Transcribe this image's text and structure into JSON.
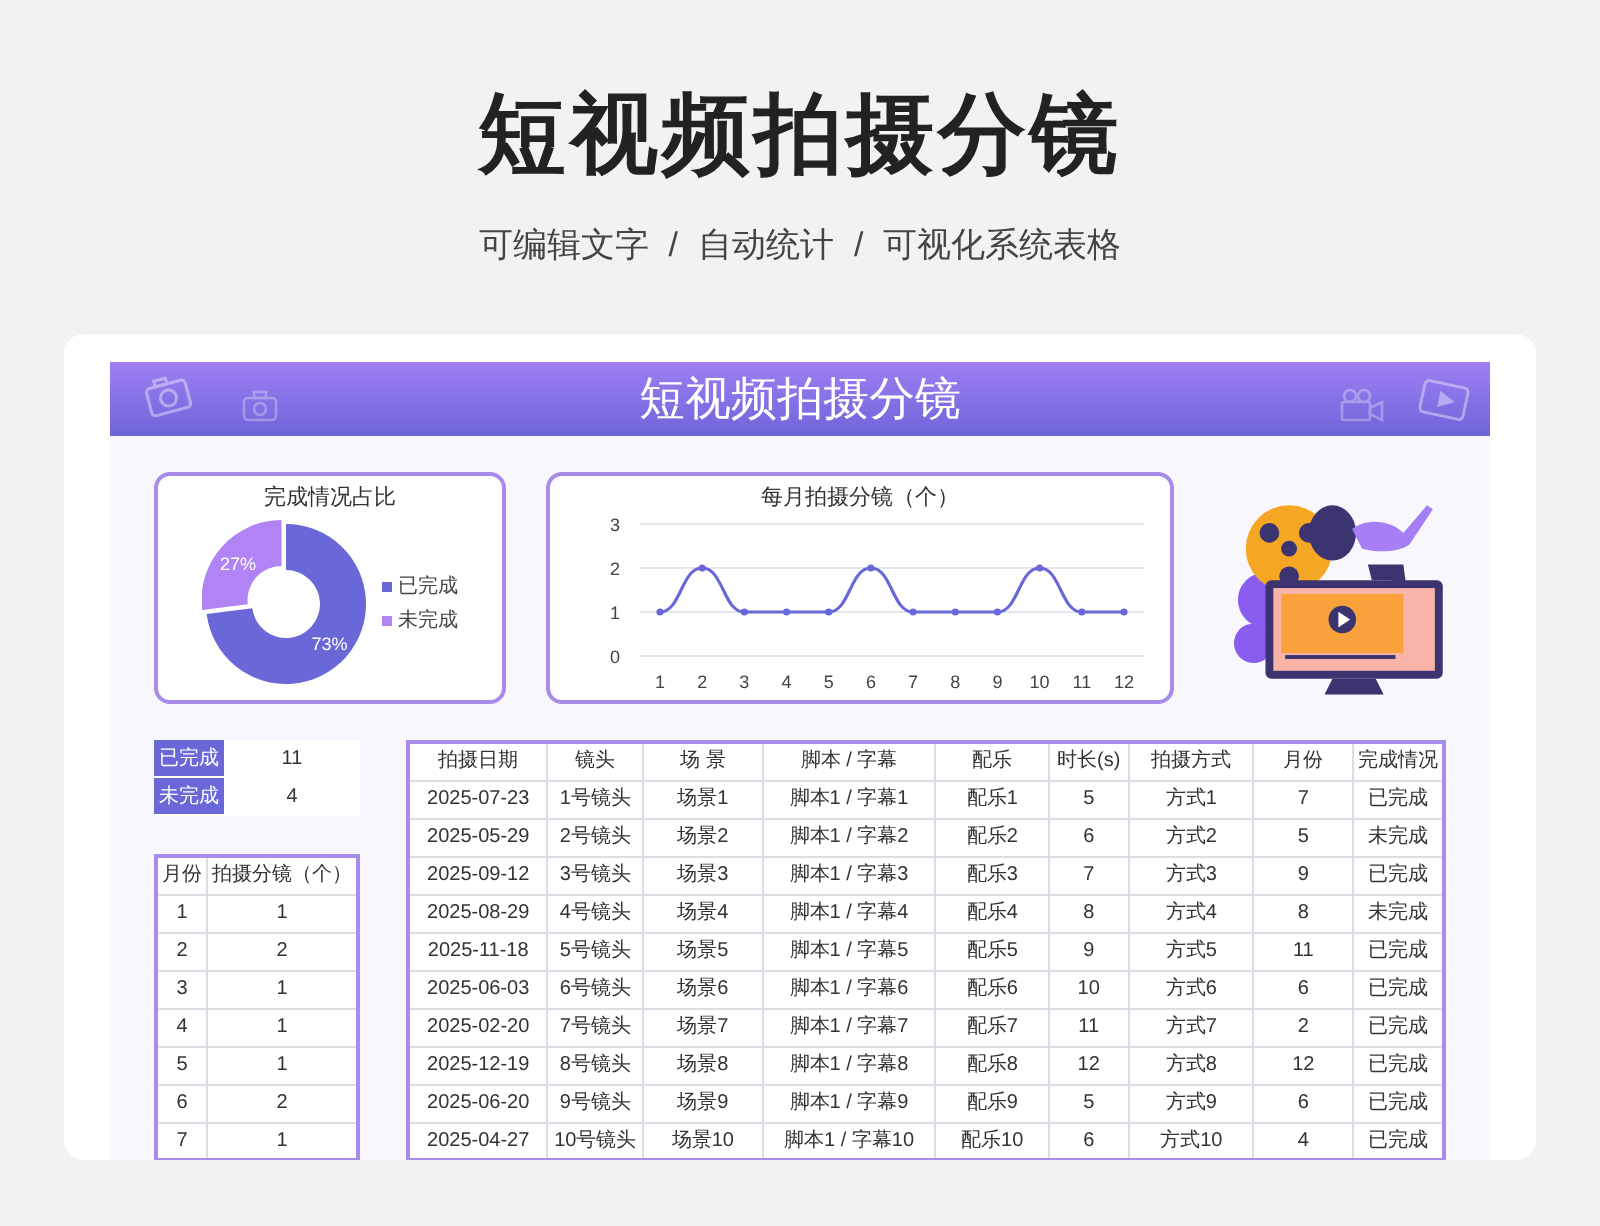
{
  "page": {
    "title": "短视频拍摄分镜",
    "subtitle": [
      "可编辑文字",
      "/",
      "自动统计",
      "/",
      "可视化系统表格"
    ]
  },
  "banner": {
    "title": "短视频拍摄分镜"
  },
  "donut": {
    "chart_data": {
      "type": "donut",
      "title": "完成情况占比",
      "categories": [
        "已完成",
        "未完成"
      ],
      "values": [
        73,
        27
      ],
      "value_labels": [
        "73%",
        "27%"
      ],
      "colors": [
        "#6a67d8",
        "#b184f5"
      ]
    }
  },
  "line": {
    "chart_data": {
      "type": "line",
      "title": "每月拍摄分镜（个）",
      "x": [
        "1",
        "2",
        "3",
        "4",
        "5",
        "6",
        "7",
        "8",
        "9",
        "10",
        "11",
        "12"
      ],
      "series": [
        {
          "color": "#6a67d8",
          "marker": true,
          "values": [
            1,
            2,
            1,
            1,
            1,
            2,
            1,
            1,
            1,
            2,
            1,
            1
          ]
        }
      ],
      "ylim": [
        0,
        3
      ],
      "yticks": [
        0,
        1,
        2,
        3
      ]
    }
  },
  "status_summary": [
    {
      "label": "已完成",
      "count": "11"
    },
    {
      "label": "未完成",
      "count": "4"
    }
  ],
  "monthly_table": {
    "columns": [
      "月份",
      "拍摄分镜（个）"
    ],
    "rows": [
      [
        "1",
        "1"
      ],
      [
        "2",
        "2"
      ],
      [
        "3",
        "1"
      ],
      [
        "4",
        "1"
      ],
      [
        "5",
        "1"
      ],
      [
        "6",
        "2"
      ],
      [
        "7",
        "1"
      ]
    ]
  },
  "shot_table": {
    "columns": [
      "拍摄日期",
      "镜头",
      "场 景",
      "脚本 / 字幕",
      "配乐",
      "时长(s)",
      "拍摄方式",
      "月份",
      "完成情况"
    ],
    "rows": [
      [
        "2025-07-23",
        "1号镜头",
        "场景1",
        "脚本1 / 字幕1",
        "配乐1",
        "5",
        "方式1",
        "7",
        "已完成"
      ],
      [
        "2025-05-29",
        "2号镜头",
        "场景2",
        "脚本1 / 字幕2",
        "配乐2",
        "6",
        "方式2",
        "5",
        "未完成"
      ],
      [
        "2025-09-12",
        "3号镜头",
        "场景3",
        "脚本1 / 字幕3",
        "配乐3",
        "7",
        "方式3",
        "9",
        "已完成"
      ],
      [
        "2025-08-29",
        "4号镜头",
        "场景4",
        "脚本1 / 字幕4",
        "配乐4",
        "8",
        "方式4",
        "8",
        "未完成"
      ],
      [
        "2025-11-18",
        "5号镜头",
        "场景5",
        "脚本1 / 字幕5",
        "配乐5",
        "9",
        "方式5",
        "11",
        "已完成"
      ],
      [
        "2025-06-03",
        "6号镜头",
        "场景6",
        "脚本1 / 字幕6",
        "配乐6",
        "10",
        "方式6",
        "6",
        "已完成"
      ],
      [
        "2025-02-20",
        "7号镜头",
        "场景7",
        "脚本1 / 字幕7",
        "配乐7",
        "11",
        "方式7",
        "2",
        "已完成"
      ],
      [
        "2025-12-19",
        "8号镜头",
        "场景8",
        "脚本1 / 字幕8",
        "配乐8",
        "12",
        "方式8",
        "12",
        "已完成"
      ],
      [
        "2025-06-20",
        "9号镜头",
        "场景9",
        "脚本1 / 字幕9",
        "配乐9",
        "5",
        "方式9",
        "6",
        "已完成"
      ],
      [
        "2025-04-27",
        "10号镜头",
        "场景10",
        "脚本1 / 字幕10",
        "配乐10",
        "6",
        "方式10",
        "4",
        "已完成"
      ]
    ]
  }
}
